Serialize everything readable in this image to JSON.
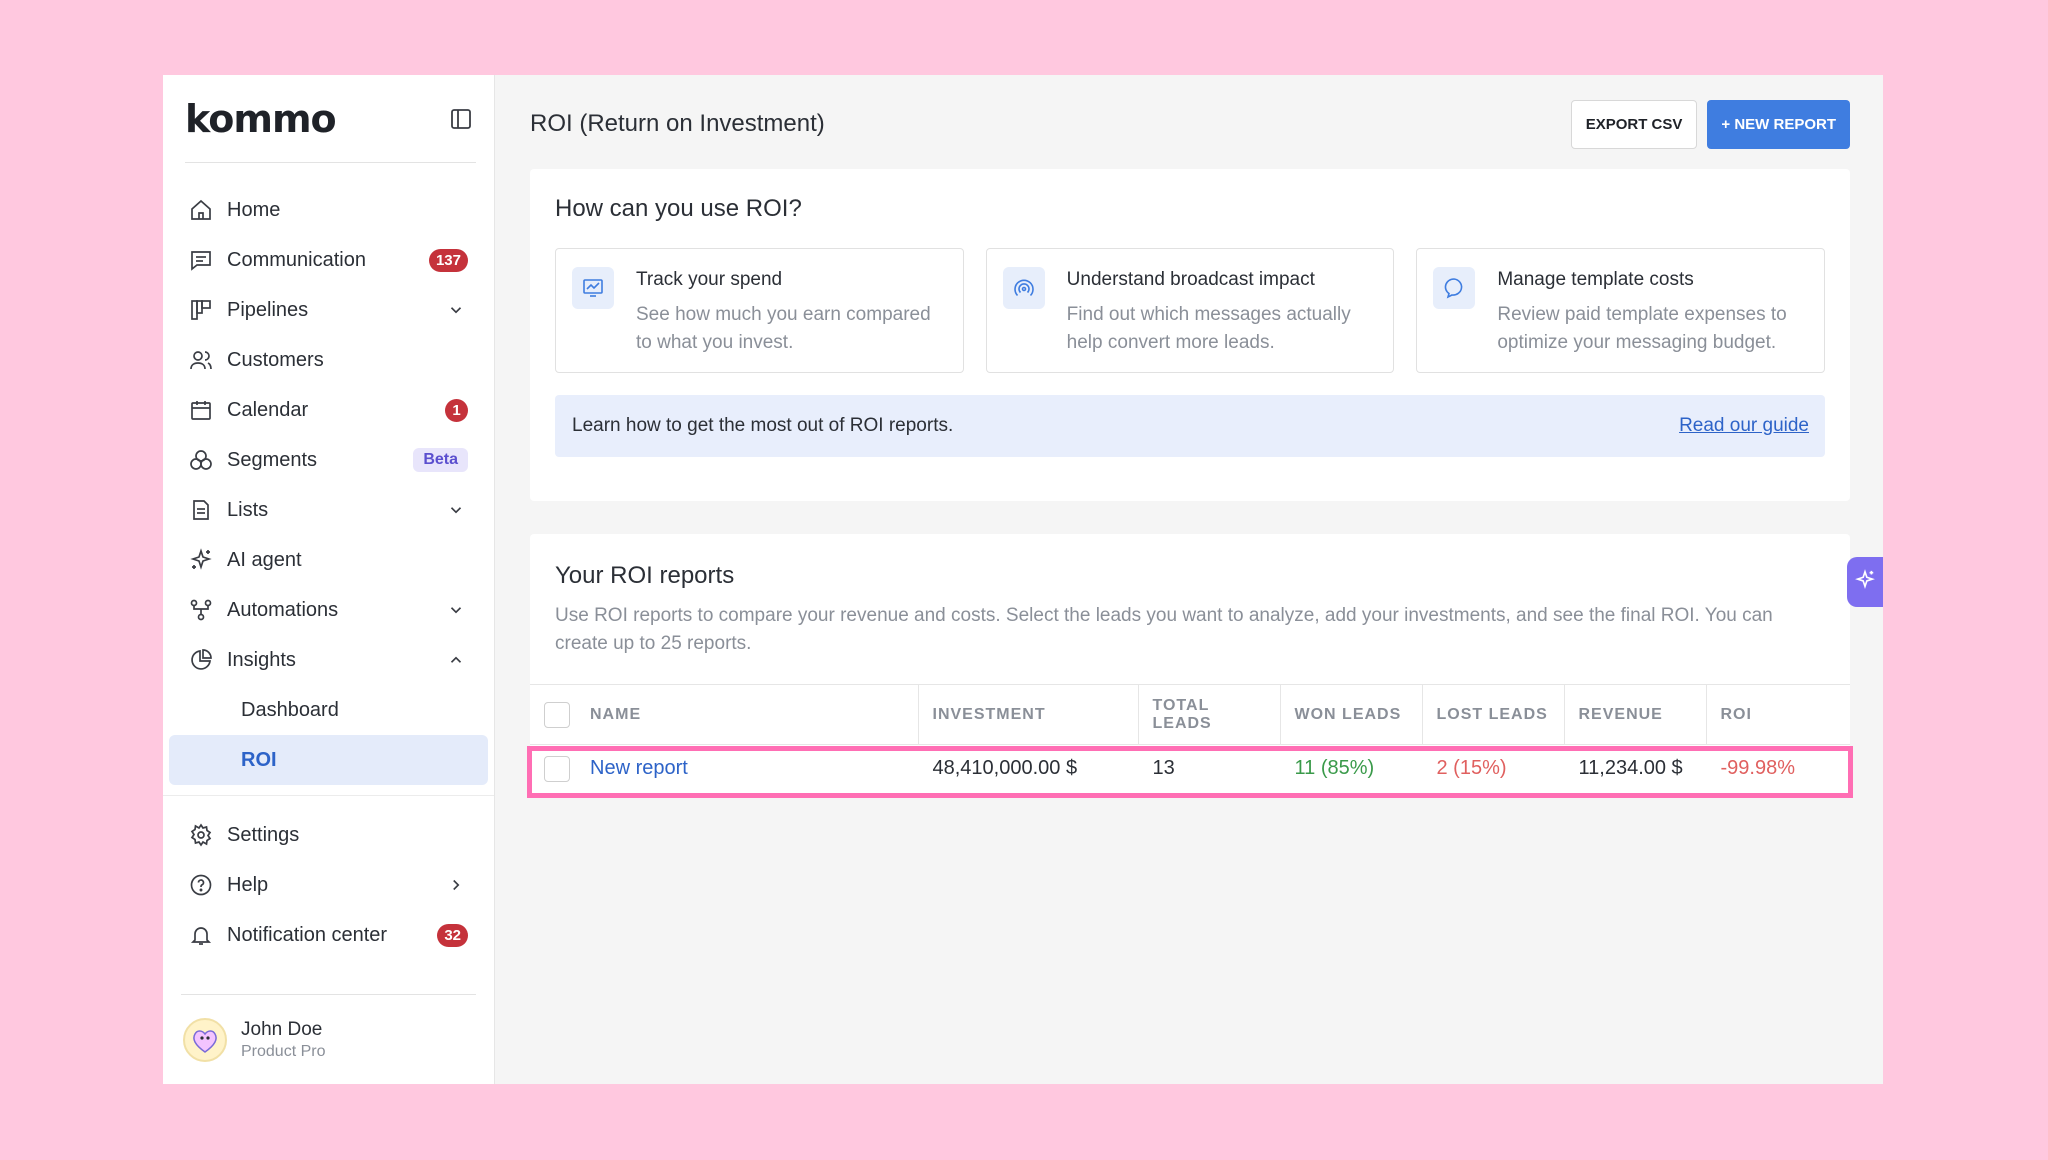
{
  "app": {
    "logo": "kommo"
  },
  "sidebar": {
    "items": [
      {
        "label": "Home",
        "icon": "home-icon"
      },
      {
        "label": "Communication",
        "icon": "chat-icon",
        "badge": "137"
      },
      {
        "label": "Pipelines",
        "icon": "pipeline-icon"
      },
      {
        "label": "Customers",
        "icon": "customers-icon"
      },
      {
        "label": "Calendar",
        "icon": "calendar-icon",
        "badge": "1"
      },
      {
        "label": "Segments",
        "icon": "segments-icon",
        "tag": "Beta"
      },
      {
        "label": "Lists",
        "icon": "list-icon"
      },
      {
        "label": "AI agent",
        "icon": "sparkle-icon"
      },
      {
        "label": "Automations",
        "icon": "automation-icon"
      },
      {
        "label": "Insights",
        "icon": "pie-chart-icon"
      }
    ],
    "insights_sub": [
      "Dashboard",
      "ROI"
    ],
    "bottom": [
      {
        "label": "Settings",
        "icon": "gear-icon"
      },
      {
        "label": "Help",
        "icon": "help-icon"
      },
      {
        "label": "Notification center",
        "icon": "bell-icon",
        "badge": "32"
      }
    ],
    "user": {
      "name": "John Doe",
      "role": "Product Pro"
    }
  },
  "header": {
    "title": "ROI (Return on Investment)",
    "export_label": "EXPORT CSV",
    "new_report_label": "+ NEW REPORT"
  },
  "how": {
    "title": "How can you use ROI?",
    "features": [
      {
        "title": "Track your spend",
        "desc": "See how much you earn compared to what you invest."
      },
      {
        "title": "Understand broadcast impact",
        "desc": "Find out which messages actually help convert more leads."
      },
      {
        "title": "Manage template costs",
        "desc": "Review paid template expenses to optimize your messaging budget."
      }
    ],
    "guide_text": "Learn how to get the most out of ROI reports.",
    "guide_link": "Read our guide"
  },
  "reports": {
    "title": "Your ROI reports",
    "desc": "Use ROI reports to compare your revenue and costs. Select the leads you want to analyze, add your investments, and see the final ROI. You can create up to 25 reports.",
    "columns": [
      "NAME",
      "INVESTMENT",
      "TOTAL LEADS",
      "WON LEADS",
      "LOST LEADS",
      "REVENUE",
      "ROI"
    ],
    "rows": [
      {
        "name": "New report",
        "investment": "48,410,000.00 $",
        "total_leads": "13",
        "won_leads": "11 (85%)",
        "lost_leads": "2 (15%)",
        "revenue": "11,234.00 $",
        "roi": "-99.98%"
      }
    ]
  },
  "colors": {
    "accent": "#3f7de0",
    "highlight": "#ff6eb4",
    "badge": "#c5323b",
    "background": "#ffc8df"
  }
}
